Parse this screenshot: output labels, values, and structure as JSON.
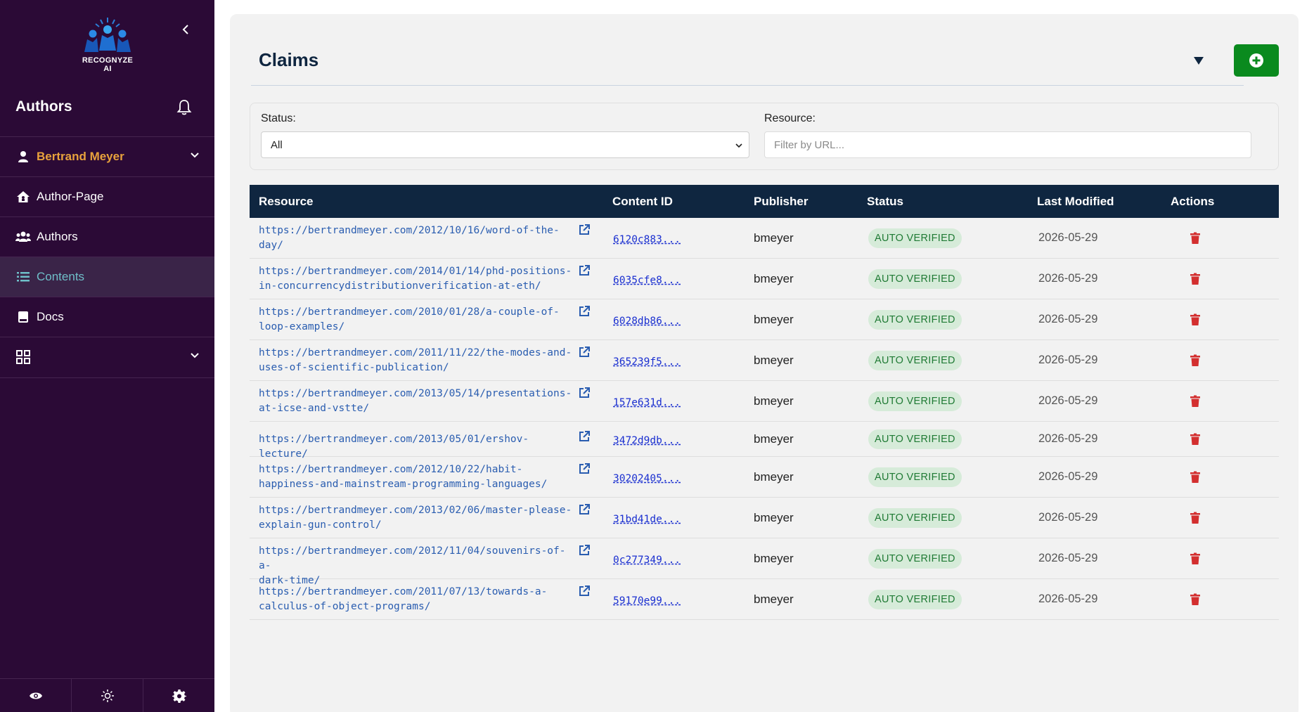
{
  "brand": {
    "logo_text": "RECOGNYZE AI"
  },
  "sidebar": {
    "title": "Authors",
    "user_name": "Bertrand Meyer",
    "items": [
      {
        "label": "Author-Page",
        "icon": "home-icon"
      },
      {
        "label": "Authors",
        "icon": "users-icon"
      },
      {
        "label": "Contents",
        "icon": "list-icon",
        "active": true
      },
      {
        "label": "Docs",
        "icon": "book-icon"
      }
    ]
  },
  "header": {
    "title": "Claims"
  },
  "filters": {
    "status_label": "Status:",
    "status_value": "All",
    "resource_label": "Resource:",
    "resource_placeholder": "Filter by URL..."
  },
  "table": {
    "columns": [
      "Resource",
      "Content ID",
      "Publisher",
      "Status",
      "Last Modified",
      "Actions"
    ],
    "rows": [
      {
        "resource": [
          "https://bertrandmeyer.com/2012/10/16/word-of-the-",
          "day/"
        ],
        "content_id": "6120c883...",
        "publisher": "bmeyer",
        "status": "AUTO VERIFIED",
        "modified": "2026-05-29"
      },
      {
        "resource": [
          "https://bertrandmeyer.com/2014/01/14/phd-positions-",
          "in-concurrencydistributionverification-at-eth/"
        ],
        "content_id": "6035cfe8...",
        "publisher": "bmeyer",
        "status": "AUTO VERIFIED",
        "modified": "2026-05-29"
      },
      {
        "resource": [
          "https://bertrandmeyer.com/2010/01/28/a-couple-of-",
          "loop-examples/"
        ],
        "content_id": "6028db86...",
        "publisher": "bmeyer",
        "status": "AUTO VERIFIED",
        "modified": "2026-05-29"
      },
      {
        "resource": [
          "https://bertrandmeyer.com/2011/11/22/the-modes-and-",
          "uses-of-scientific-publication/"
        ],
        "content_id": "365239f5...",
        "publisher": "bmeyer",
        "status": "AUTO VERIFIED",
        "modified": "2026-05-29"
      },
      {
        "resource": [
          "https://bertrandmeyer.com/2013/05/14/presentations-",
          "at-icse-and-vstte/"
        ],
        "content_id": "157e631d...",
        "publisher": "bmeyer",
        "status": "AUTO VERIFIED",
        "modified": "2026-05-29"
      },
      {
        "resource": [
          "https://bertrandmeyer.com/2013/05/01/ershov-lecture/"
        ],
        "content_id": "3472d9db...",
        "publisher": "bmeyer",
        "status": "AUTO VERIFIED",
        "modified": "2026-05-29"
      },
      {
        "resource": [
          "https://bertrandmeyer.com/2012/10/22/habit-",
          "happiness-and-mainstream-programming-languages/"
        ],
        "content_id": "30202405...",
        "publisher": "bmeyer",
        "status": "AUTO VERIFIED",
        "modified": "2026-05-29"
      },
      {
        "resource": [
          "https://bertrandmeyer.com/2013/02/06/master-please-",
          "explain-gun-control/"
        ],
        "content_id": "31bd41de...",
        "publisher": "bmeyer",
        "status": "AUTO VERIFIED",
        "modified": "2026-05-29"
      },
      {
        "resource": [
          "https://bertrandmeyer.com/2012/11/04/souvenirs-of-a-",
          "dark-time/"
        ],
        "content_id": "0c277349...",
        "publisher": "bmeyer",
        "status": "AUTO VERIFIED",
        "modified": "2026-05-29"
      },
      {
        "resource": [
          "https://bertrandmeyer.com/2011/07/13/towards-a-",
          "calculus-of-object-programs/"
        ],
        "content_id": "59170e99...",
        "publisher": "bmeyer",
        "status": "AUTO VERIFIED",
        "modified": "2026-05-29"
      }
    ]
  },
  "colors": {
    "sidebar_bg": "#2b0a36",
    "header_bg": "#0f2640",
    "user_accent": "#e8a23c",
    "active_item": "#6fbfc9",
    "add_button": "#0a8a1e",
    "badge_bg": "#d6ebd9",
    "badge_text": "#1f7a34",
    "delete": "#d32f2f",
    "link": "#2a5db0"
  }
}
